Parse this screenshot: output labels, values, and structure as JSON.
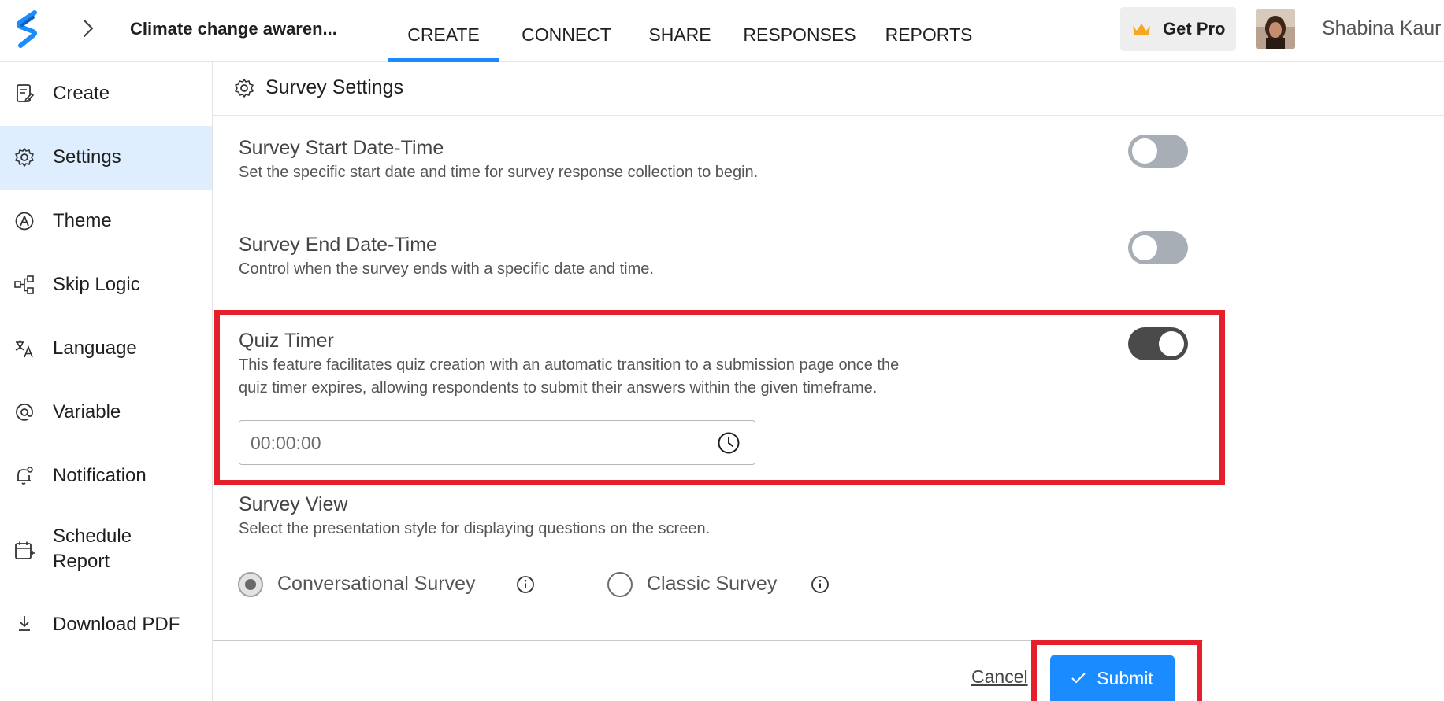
{
  "header": {
    "survey_name": "Climate change awaren...",
    "tabs": [
      {
        "label": "CREATE",
        "active": true
      },
      {
        "label": "CONNECT",
        "active": false
      },
      {
        "label": "SHARE",
        "active": false
      },
      {
        "label": "RESPONSES",
        "active": false
      },
      {
        "label": "REPORTS",
        "active": false
      }
    ],
    "get_pro_label": "Get Pro",
    "user_name": "Shabina Kaur"
  },
  "sidebar": {
    "items": [
      {
        "label": "Create",
        "icon": "create-icon"
      },
      {
        "label": "Settings",
        "icon": "gear-icon",
        "active": true
      },
      {
        "label": "Theme",
        "icon": "theme-icon"
      },
      {
        "label": "Skip Logic",
        "icon": "skip-logic-icon"
      },
      {
        "label": "Language",
        "icon": "language-icon"
      },
      {
        "label": "Variable",
        "icon": "at-icon"
      },
      {
        "label": "Notification",
        "icon": "bell-icon"
      },
      {
        "label": "Schedule Report",
        "label_line1": "Schedule",
        "label_line2": "Report",
        "icon": "calendar-icon"
      },
      {
        "label": "Download PDF",
        "icon": "download-icon"
      }
    ]
  },
  "main": {
    "section_title": "Survey Settings",
    "settings": {
      "start": {
        "title": "Survey Start Date-Time",
        "description": "Set the specific start date and time for survey response collection to begin.",
        "enabled": false
      },
      "end": {
        "title": "Survey End Date-Time",
        "description": "Control when the survey ends with a specific date and time.",
        "enabled": false
      },
      "quiz_timer": {
        "title": "Quiz Timer",
        "description_line1": "This feature facilitates quiz creation with an automatic transition to a submission page once the",
        "description_line2": "quiz timer expires, allowing respondents to submit their answers within the given timeframe.",
        "enabled": true,
        "time_placeholder": "00:00:00",
        "time_value": ""
      },
      "survey_view": {
        "title": "Survey View",
        "description": "Select the presentation style for displaying questions on the screen.",
        "options": [
          {
            "label": "Conversational Survey",
            "selected": true
          },
          {
            "label": "Classic Survey",
            "selected": false
          }
        ]
      }
    },
    "footer": {
      "cancel_label": "Cancel",
      "submit_label": "Submit"
    }
  },
  "colors": {
    "accent": "#1a8cff",
    "highlight": "#e5202a",
    "active_sidebar_bg": "#deeefe",
    "toggle_off": "#a7aeb6",
    "toggle_on": "#4a4a4a"
  }
}
